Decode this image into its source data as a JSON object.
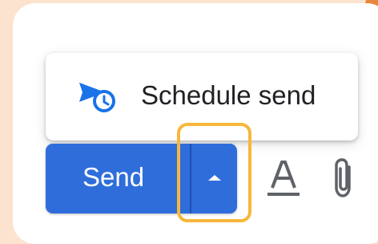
{
  "colors": {
    "background": "#fbe3cf",
    "accent_dot": "#e8863e",
    "send_blue": "#2f6ddb",
    "highlight_outline": "#f6b73c",
    "icon_blue": "#1a73e8",
    "icon_gray": "#5f6368"
  },
  "menu": {
    "schedule_send_label": "Schedule send",
    "schedule_send_icon": "schedule-send-icon"
  },
  "toolbar": {
    "send_label": "Send",
    "send_options_icon": "caret-up-icon",
    "format_icon": "text-format-icon",
    "attach_icon": "paperclip-icon"
  }
}
